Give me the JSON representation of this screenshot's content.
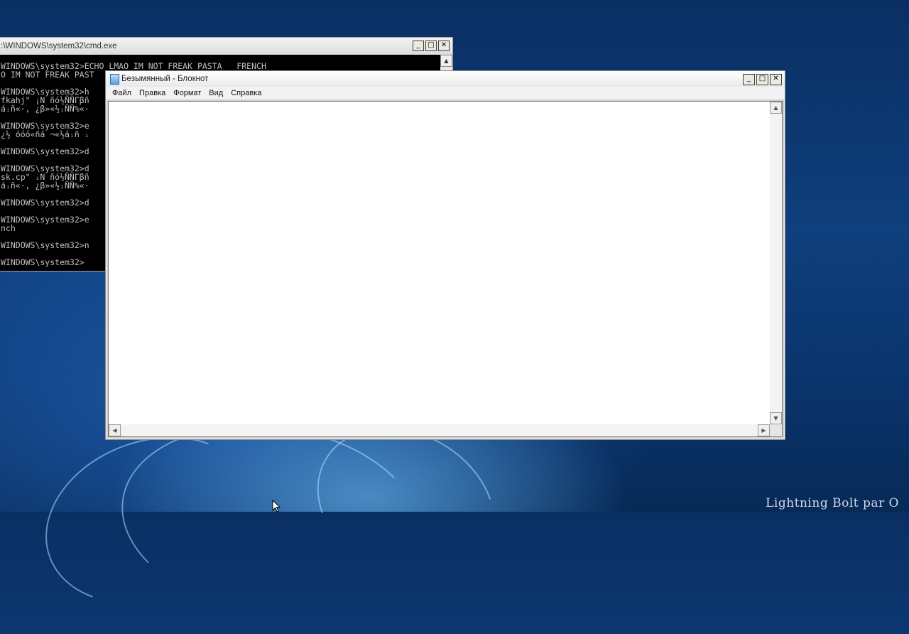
{
  "cmd": {
    "title": ":\\WINDOWS\\system32\\cmd.exe",
    "lines": "WINDOWS\\system32>ECHO LMAO IM NOT FREAK PASTA   FRENCH\nO IM NOT FREAK PAST\n\nWINDOWS\\system32>h\nfkahj\" ¡N ñó½ÑÑΓβñ\náᵢñ«·, ¿β»«½ᵢÑÑ%«·\n\nWINDOWS\\system32>e\n¿½ óóó«ñá ¬«½áᵢñ ᵢ\n\nWINDOWS\\system32>d\n\nWINDOWS\\system32>d\nsk.cp\" ᵢN ñó½ÑÑΓβñ\náᵢñ«·, ¿β»«½ᵢÑÑ%«·\n\nWINDOWS\\system32>d\n\nWINDOWS\\system32>e\nnch\n\nWINDOWS\\system32>n\n\nWINDOWS\\system32>",
    "minimize_glyph": "_",
    "maximize_glyph": "□",
    "close_glyph": "✕"
  },
  "notepad": {
    "title": "Безымянный - Блокнот",
    "menu": [
      "Файл",
      "Правка",
      "Формат",
      "Вид",
      "Справка"
    ],
    "content": "",
    "minimize_glyph": "_",
    "maximize_glyph": "□",
    "close_glyph": "✕"
  },
  "wallpaper": {
    "signature": "Lightning Bolt par O"
  }
}
